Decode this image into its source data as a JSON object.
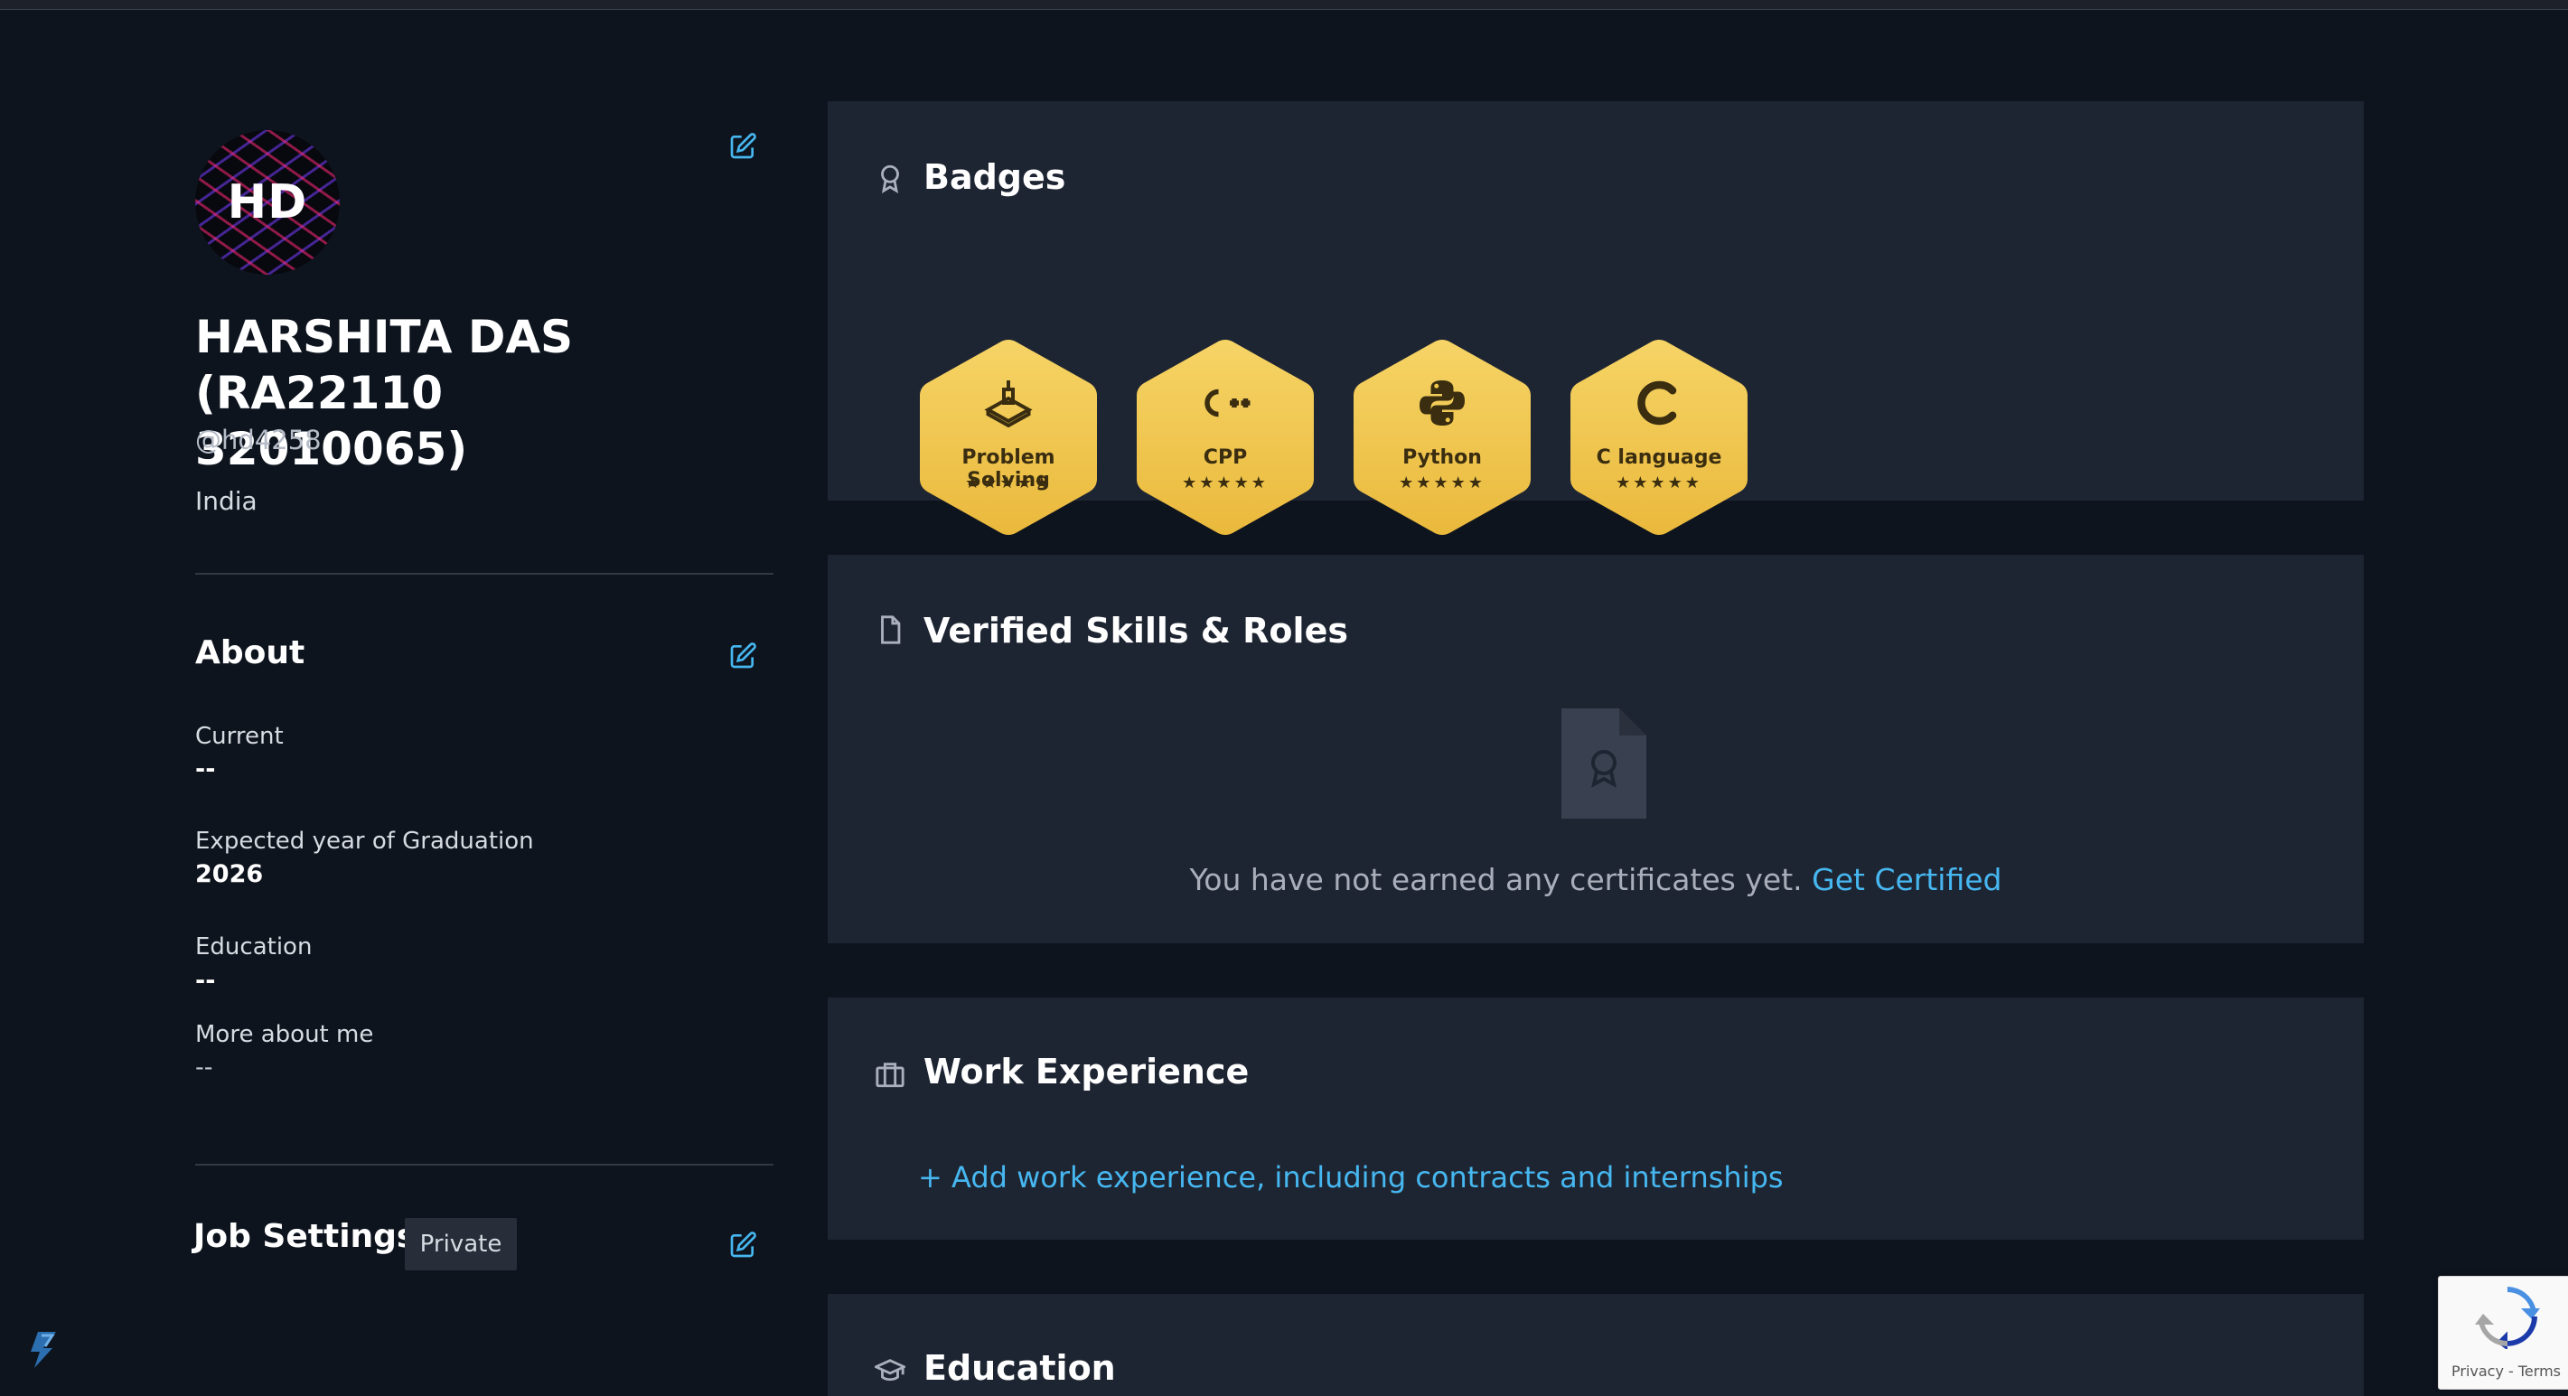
{
  "profile": {
    "initials": "HD",
    "name": "HARSHITA DAS (RA2211032010065)",
    "name_line1": "HARSHITA DAS (RA22110",
    "name_line2": "32010065)",
    "handle": "@hd4258",
    "country": "India"
  },
  "about": {
    "title": "About",
    "items": [
      {
        "label": "Current",
        "value": "--"
      },
      {
        "label": "Expected year of Graduation",
        "value": "2026"
      },
      {
        "label": "Education",
        "value": "--"
      },
      {
        "label": "More about me",
        "value": "--"
      }
    ]
  },
  "job_settings": {
    "title": "Job Settings",
    "visibility": "Private"
  },
  "badges": {
    "title": "Badges",
    "items": [
      {
        "name": "Problem Solving",
        "stars": "★★★★★",
        "icon": "problem-solving-icon"
      },
      {
        "name": "CPP",
        "stars": "★★★★★",
        "icon": "cpp-icon"
      },
      {
        "name": "Python",
        "stars": "★★★★★",
        "icon": "python-icon"
      },
      {
        "name": "C language",
        "stars": "★★★★★",
        "icon": "c-language-icon"
      }
    ]
  },
  "skills": {
    "title": "Verified Skills & Roles",
    "empty_message": "You have not earned any certificates yet.",
    "cta": "Get Certified"
  },
  "work": {
    "title": "Work Experience",
    "add_label": "+ Add work experience, including contracts and internships"
  },
  "education": {
    "title": "Education"
  },
  "recaptcha": {
    "text": "Privacy - Terms"
  },
  "colors": {
    "page_bg": "#0e141e",
    "card_bg": "#1e2532",
    "accent_link": "#46b7f0",
    "badge_gold": "#f2c84b"
  }
}
